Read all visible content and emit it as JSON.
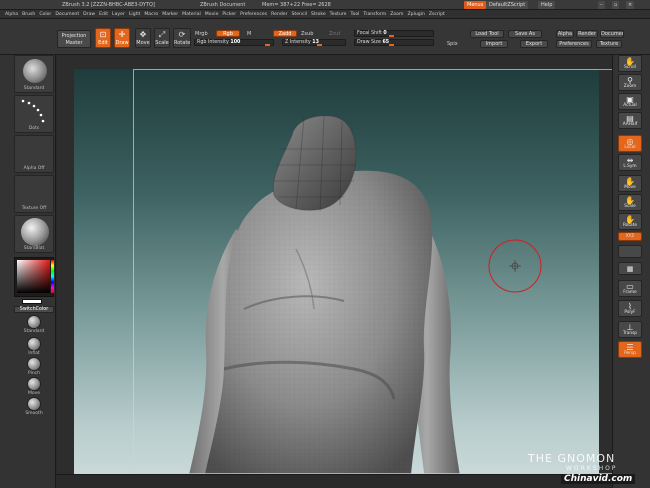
{
  "titlebar": {
    "app": "ZBrush 3.2 [ZZZN-BHBC-ABE3-DYTQ]",
    "document": "ZBrush Document",
    "mem": "Mem= 387+22  Free= 2628",
    "menus_btn": "Menus",
    "script_btn": "DefaultZScript",
    "help_btn": "Help"
  },
  "menubar": {
    "items": [
      "Alpha",
      "Brush",
      "Color",
      "Document",
      "Draw",
      "Edit",
      "Layer",
      "Light",
      "Macro",
      "Marker",
      "Material",
      "Movie",
      "Picker",
      "Preferences",
      "Render",
      "Stencil",
      "Stroke",
      "Texture",
      "Tool",
      "Transform",
      "Zoom",
      "Zplugin",
      "Zscript"
    ]
  },
  "shelf": {
    "projection_master": "Projection Master",
    "edit": "Edit",
    "draw": "Draw",
    "move": "Move",
    "scale": "Scale",
    "rotate": "Rotate",
    "mrgb": "Mrgb",
    "rgb": "Rgb",
    "m": "M",
    "zadd": "Zadd",
    "zsub": "Zsub",
    "zcut": "Zcut",
    "rgb_intensity_label": "Rgb Intensity",
    "rgb_intensity_value": "100",
    "z_intensity_label": "Z Intensity",
    "z_intensity_value": "13",
    "focal_shift_label": "Focal Shift",
    "focal_shift_value": "0",
    "draw_size_label": "Draw Size",
    "draw_size_value": "65",
    "load_tool": "Load Tool",
    "save_as": "Save As",
    "spix": "Spix",
    "import": "Import",
    "export": "Export",
    "alpha": "Alpha",
    "render": "Render",
    "document": "Document",
    "preferences": "Preferences",
    "texture": "Texture"
  },
  "lefttray": {
    "standard": "Standard",
    "dots": "Dots",
    "alpha_off": "Alpha Off",
    "texture_off": "Texture Off",
    "material": "StarsBlat",
    "switch_color": "SwitchColor",
    "brush_standard": "Standard",
    "inflat": "Inflat",
    "pinch": "Pinch",
    "move": "Move",
    "smooth": "Smooth"
  },
  "righttray": {
    "scroll": "Scroll",
    "zoom": "Zoom",
    "actual": "Actual",
    "aahalf": "AAHalf",
    "local": "Local",
    "xyz_sym": "L.Sym",
    "move": "Move",
    "scale": "Scale",
    "rotate": "Rotate",
    "xyz": "XYZ",
    "frame": "Frame",
    "polyf": "PolyF",
    "transp": "Transp",
    "persp": "Persp"
  },
  "watermark": {
    "gnomon_line1": "THE GNOMON",
    "gnomon_line2": "WORKSHOP",
    "site": "Chinavid.com"
  },
  "colors": {
    "accent": "#e2661c",
    "brush_ring": "#d21e1e"
  }
}
